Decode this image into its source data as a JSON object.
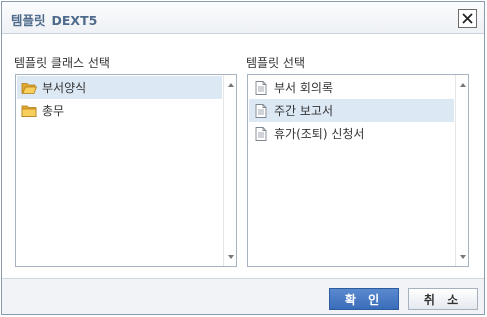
{
  "dialog": {
    "title": "템플릿",
    "app_name": "DEXT5"
  },
  "left_panel": {
    "label": "템플릿 클래스 선택",
    "items": [
      {
        "label": "부서양식",
        "icon": "open-folder-icon",
        "selected": true
      },
      {
        "label": "총무",
        "icon": "folder-icon",
        "selected": false
      }
    ]
  },
  "right_panel": {
    "label": "템플릿 선택",
    "items": [
      {
        "label": "부서 회의록",
        "icon": "document-icon",
        "selected": false
      },
      {
        "label": "주간 보고서",
        "icon": "document-icon",
        "selected": true
      },
      {
        "label": "휴가(조퇴) 신청서",
        "icon": "document-icon",
        "selected": false
      }
    ]
  },
  "buttons": {
    "ok_label": "확 인",
    "cancel_label": "취 소"
  },
  "colors": {
    "title_text": "#4f6b8c",
    "selection": "#dde8f5",
    "ok_button": "#3a6db9",
    "folder": "#f2c14e"
  }
}
